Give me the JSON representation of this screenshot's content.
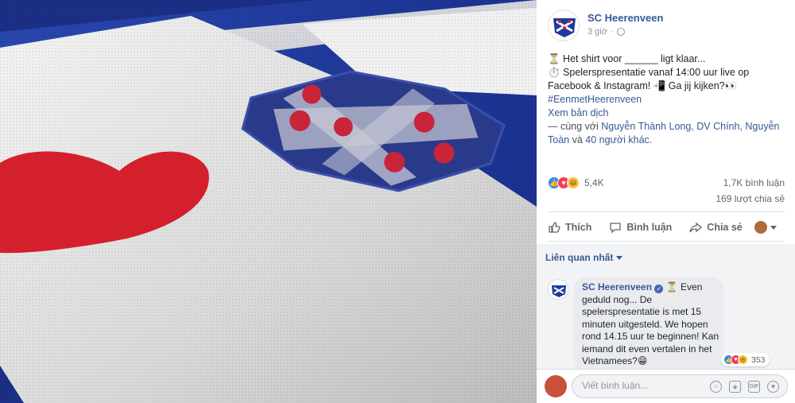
{
  "post": {
    "page_name": "SC Heerenveen",
    "time": "3 giờ",
    "lines": [
      "⏳ Het shirt voor ______ ligt klaar...",
      "⏱️ Spelerspresentatie vanaf 14:00 uur live op",
      "Facebook & Instagram! 📲 Ga jij kijken?👀"
    ],
    "hashtag": "#EenmetHeerenveen",
    "translate": "Xem bản dịch",
    "tag_prefix": "— cùng với ",
    "tag_people": "Nguyễn Thành Long, DV Chính, Nguyễn",
    "tag_people_2": "Toàn",
    "tag_and": " và ",
    "tag_others": "40 người khác",
    "tag_end": "."
  },
  "stats": {
    "reaction_count": "5,4K",
    "comments": "1,7K bình luận",
    "shares": "169 lượt chia sẻ"
  },
  "actions": {
    "like": "Thích",
    "comment": "Bình luận",
    "share": "Chia sẻ"
  },
  "relevance": {
    "label": "Liên quan nhất"
  },
  "comment": {
    "author": "SC Heerenveen",
    "verified_mark": "✓",
    "lines": [
      "⏳ Even",
      "geduld nog... De",
      "spelerspresentatie is met 15",
      "minuten uitgesteld. We hopen",
      "rond 14.15 uur te beginnen! Kan",
      "iemand dit even vertalen in het",
      "Vietnamees?😁"
    ],
    "reaction_count": "353"
  },
  "composer": {
    "placeholder": "Viết bình luận..."
  },
  "icons": {
    "globe": "globe-icon",
    "like": "thumbs-up-icon",
    "comment": "comment-icon",
    "share": "share-arrow-icon",
    "emoji": "emoji-icon",
    "camera": "camera-icon",
    "gif": "gif-icon",
    "sticker": "sticker-icon",
    "gif_label": "GIF"
  },
  "colors": {
    "brand_blue": "#385898",
    "shirt_blue": "#1f3a9e",
    "heart_red": "#d41f2d"
  }
}
